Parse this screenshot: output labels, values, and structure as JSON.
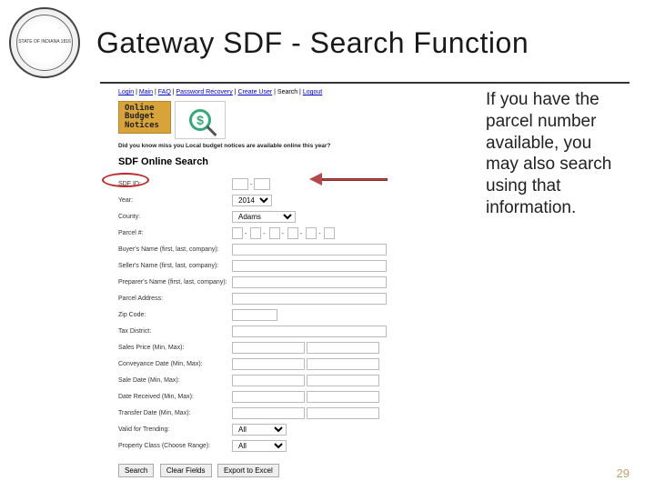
{
  "seal_label": "STATE OF INDIANA 1816",
  "title": "Gateway SDF - Search Function",
  "breadcrumb": {
    "items": [
      "Login",
      "Main",
      "FAQ",
      "Password Recovery",
      "Create User",
      "Search",
      "Logout"
    ]
  },
  "obn": {
    "line1": "Online",
    "line2": "Budget",
    "line3": "Notices"
  },
  "miss_text": "Did you know miss you Local budget notices are available online this year?",
  "search_title": "SDF Online Search",
  "callout_text": "If you have the parcel number available, you may also search using that information.",
  "form": {
    "sdf_id": "SDF ID:",
    "year": "Year:",
    "year_value": "2014",
    "county": "County:",
    "county_value": "Adams",
    "parcel": "Parcel #:",
    "buyer": "Buyer's Name (first, last, company):",
    "seller": "Seller's Name (first, last, company):",
    "preparer": "Preparer's Name (first, last, company):",
    "address": "Parcel Address:",
    "zip": "Zip Code:",
    "taxdist": "Tax District:",
    "sales": "Sales Price (Min, Max):",
    "convey": "Conveyance Date (Min, Max):",
    "saledate": "Sale Date (Min, Max):",
    "daterec": "Date Received (Min, Max):",
    "transfer": "Transfer Date (Min, Max):",
    "valid": "Valid for Trending:",
    "valid_value": "All",
    "propclass": "Property Class (Choose Range):",
    "propclass_value": "All"
  },
  "buttons": {
    "search": "Search",
    "clear": "Clear Fields",
    "export": "Export to Excel"
  },
  "page_number": "29"
}
